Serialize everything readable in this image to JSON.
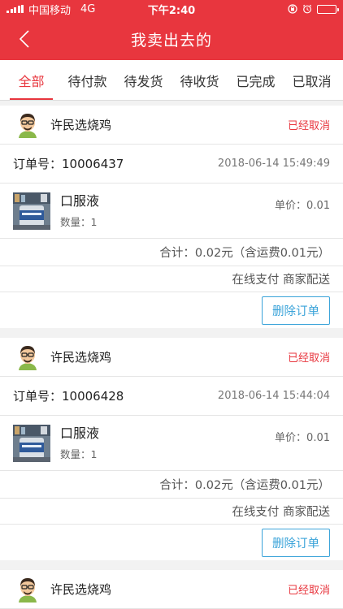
{
  "status_bar": {
    "carrier": "中国移动",
    "network": "4G",
    "time": "下午2:40"
  },
  "nav": {
    "title": "我卖出去的",
    "back_icon": "chevron-left-icon"
  },
  "tabs": [
    {
      "label": "全部",
      "active": true
    },
    {
      "label": "待付款",
      "active": false
    },
    {
      "label": "待发货",
      "active": false
    },
    {
      "label": "待收货",
      "active": false
    },
    {
      "label": "已完成",
      "active": false
    },
    {
      "label": "已取消",
      "active": false
    }
  ],
  "colors": {
    "brand_red": "#e8363e",
    "button_blue": "#3aa3d9"
  },
  "orders": [
    {
      "shop_name": "许民选烧鸡",
      "status": "已经取消",
      "order_no": "订单号：10006437",
      "time": "2018-06-14 15:49:49",
      "product_name": "口服液",
      "quantity": "数量：1",
      "unit_price": "单价：0.01",
      "total": "合计：0.02元（含运费0.01元）",
      "payment": "在线支付 商家配送",
      "delete_label": "删除订单"
    },
    {
      "shop_name": "许民选烧鸡",
      "status": "已经取消",
      "order_no": "订单号：10006428",
      "time": "2018-06-14 15:44:04",
      "product_name": "口服液",
      "quantity": "数量：1",
      "unit_price": "单价：0.01",
      "total": "合计：0.02元（含运费0.01元）",
      "payment": "在线支付 商家配送",
      "delete_label": "删除订单"
    },
    {
      "shop_name": "许民选烧鸡",
      "status": "已经取消"
    }
  ]
}
